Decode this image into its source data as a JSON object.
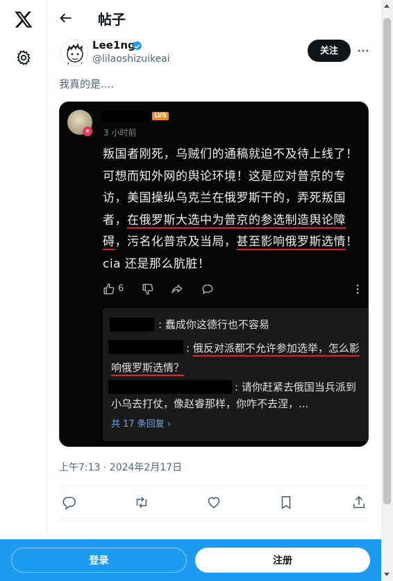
{
  "rail": {
    "logo_icon": "x-logo-icon",
    "settings_icon": "gear-icon"
  },
  "header": {
    "title": "帖子"
  },
  "author": {
    "name": "Lee1ng",
    "handle": "@lilaoshizuikeai",
    "follow_label": "关注"
  },
  "post": {
    "text": "我真的是...."
  },
  "embedded": {
    "level_badge": "LV5",
    "avatar_badge": "★",
    "time": "3 小时前",
    "body": {
      "p1": "叛国者刚死，乌贼们的通稿就迫不及待上线了！可想而知外网的舆论环境！这是应对普京的专访，美国操纵乌克兰在俄罗斯干的，弄死叛国者，",
      "u1": "在俄罗斯大选中为普京的参选制造舆论障碍",
      "p2": "，污名化普京及当局，",
      "u2": "甚至影响俄罗斯选情",
      "p3": "！cia 还是那么肮脏！"
    },
    "like_count": "6",
    "replies": [
      {
        "colon": ":",
        "text": "蠢成你这德行也不容易"
      },
      {
        "colon": ":",
        "text": "俄反对派都不允许参加选举，怎么影响俄罗斯选情？"
      },
      {
        "colon": ":",
        "text": "请你赶紧去俄国当兵派到小乌去打仗，像赵睿那样，你咋不去涅，..."
      }
    ],
    "more_replies": "共 17 条回复 ›"
  },
  "meta": {
    "timestamp": "上午7:13 · 2024年2月17日"
  },
  "bottom": {
    "login_label": "登录",
    "register_label": "注册"
  },
  "colors": {
    "accent": "#1d9bf0",
    "verified": "#1d9bf0",
    "underline": "#e0202e"
  }
}
